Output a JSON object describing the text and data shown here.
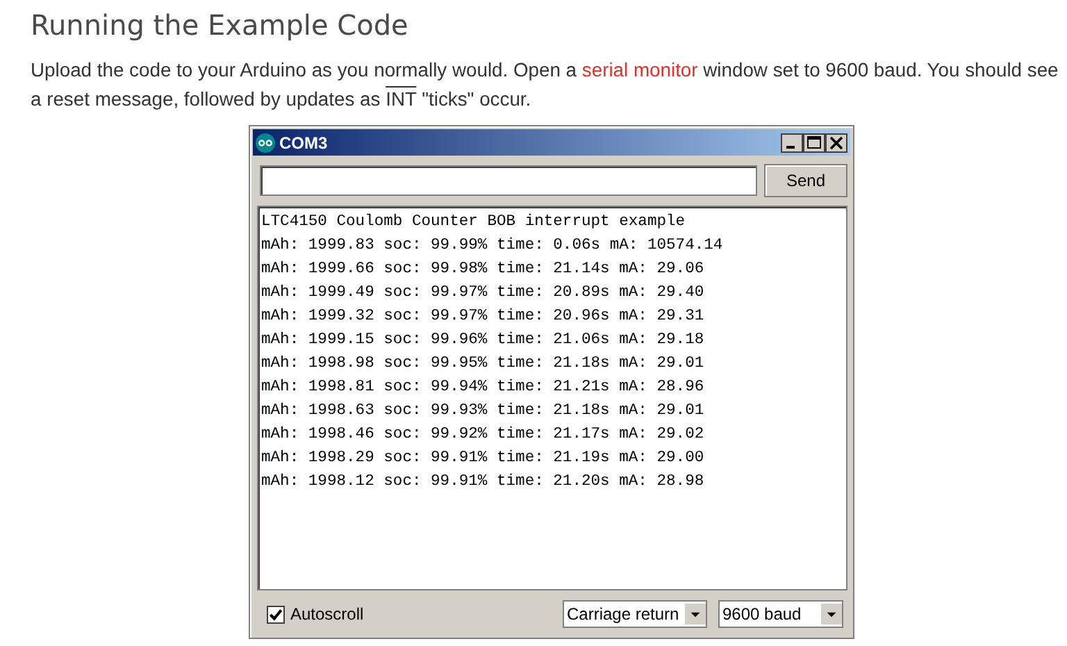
{
  "heading": "Running the Example Code",
  "paragraph": {
    "before": "Upload the code to your Arduino as you normally would. Open a ",
    "link": "serial monitor",
    "middle": " window set to 9600 baud. You should see a reset message, followed by updates as ",
    "overlined": "INT",
    "after": " \"ticks\" occur."
  },
  "window": {
    "title": "COM3",
    "send_button": "Send",
    "output_lines": [
      "LTC4150 Coulomb Counter BOB interrupt example",
      "mAh: 1999.83 soc: 99.99% time: 0.06s mA: 10574.14",
      "mAh: 1999.66 soc: 99.98% time: 21.14s mA: 29.06",
      "mAh: 1999.49 soc: 99.97% time: 20.89s mA: 29.40",
      "mAh: 1999.32 soc: 99.97% time: 20.96s mA: 29.31",
      "mAh: 1999.15 soc: 99.96% time: 21.06s mA: 29.18",
      "mAh: 1998.98 soc: 99.95% time: 21.18s mA: 29.01",
      "mAh: 1998.81 soc: 99.94% time: 21.21s mA: 28.96",
      "mAh: 1998.63 soc: 99.93% time: 21.18s mA: 29.01",
      "mAh: 1998.46 soc: 99.92% time: 21.17s mA: 29.02",
      "mAh: 1998.29 soc: 99.91% time: 21.19s mA: 29.00",
      "mAh: 1998.12 soc: 99.91% time: 21.20s mA: 28.98"
    ],
    "autoscroll": {
      "label": "Autoscroll",
      "checked": true
    },
    "line_ending": "Carriage return",
    "baud_rate": "9600 baud"
  }
}
